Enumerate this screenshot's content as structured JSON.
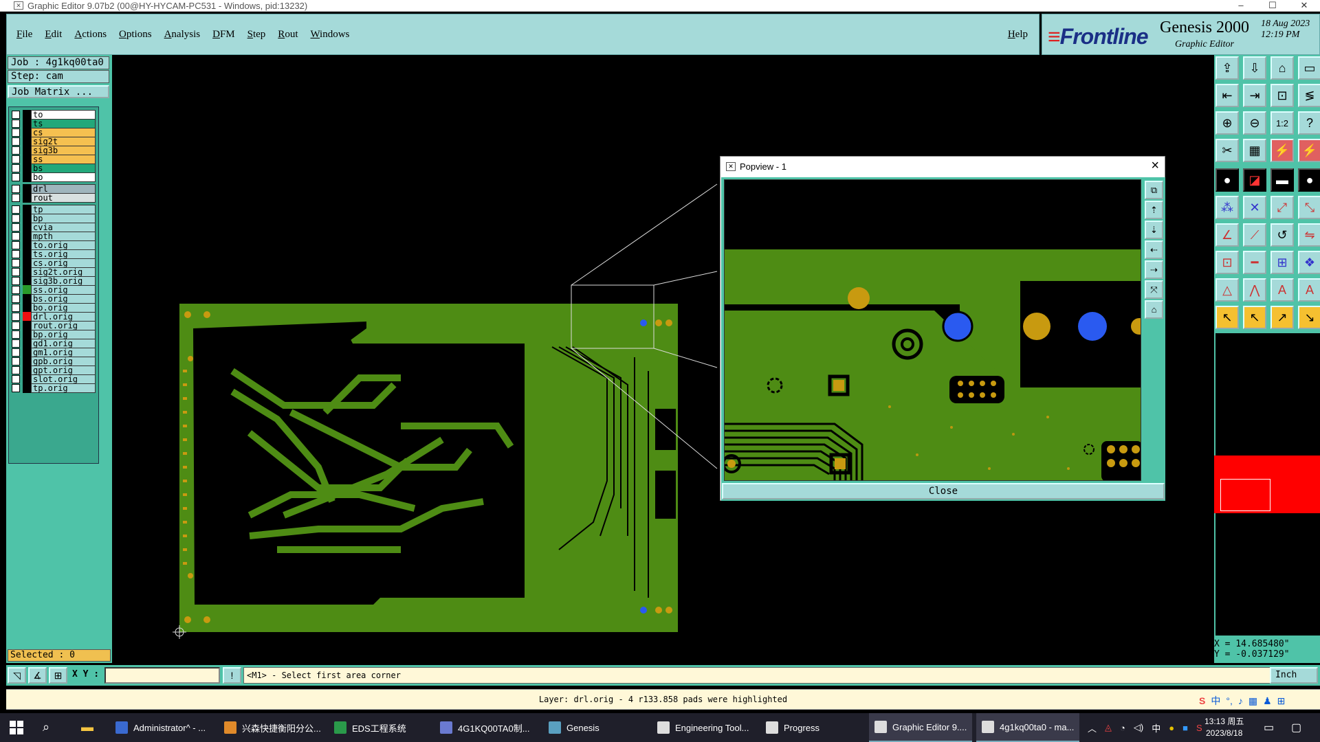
{
  "window": {
    "title": "Graphic Editor 9.07b2 (00@HY-HYCAM-PC531 - Windows, pid:13232)",
    "controls": [
      "–",
      "☐",
      "✕"
    ]
  },
  "menu": {
    "items": [
      "File",
      "Edit",
      "Actions",
      "Options",
      "Analysis",
      "DFM",
      "Step",
      "Rout",
      "Windows"
    ],
    "help": "Help"
  },
  "brand": {
    "logo": "Frontline",
    "product": "Genesis 2000",
    "subtitle": "Graphic Editor",
    "date": "18 Aug 2023\n12:19 PM"
  },
  "job": {
    "job_label": "Job : 4g1kq00ta0",
    "step_label": "Step: cam",
    "matrix_button": "Job Matrix ..."
  },
  "layers": [
    {
      "name": "to",
      "bg": "#ffffff",
      "color": "#000000"
    },
    {
      "name": "ts",
      "bg": "#23a87a",
      "color": "#000000"
    },
    {
      "name": "cs",
      "bg": "#f5c050",
      "color": "#000000"
    },
    {
      "name": "sig2t",
      "bg": "#f5c050",
      "color": "#000000"
    },
    {
      "name": "sig3b",
      "bg": "#f5c050",
      "color": "#000000"
    },
    {
      "name": "ss",
      "bg": "#f5c050",
      "color": "#000000"
    },
    {
      "name": "bs",
      "bg": "#23a87a",
      "color": "#000000"
    },
    {
      "name": "bo",
      "bg": "#ffffff",
      "color": "#000000"
    },
    {
      "name": "drl",
      "bg": "#9fb5bd",
      "color": "#000000"
    },
    {
      "name": "rout",
      "bg": "#d8e0e0",
      "color": "#000000"
    },
    {
      "name": "tp",
      "bg": "#a5dad9",
      "color": "#000000"
    },
    {
      "name": "bp",
      "bg": "#a5dad9",
      "color": "#000000"
    },
    {
      "name": "cvia",
      "bg": "#a5dad9",
      "color": "#000000"
    },
    {
      "name": "mpth",
      "bg": "#a5dad9",
      "color": "#000000"
    },
    {
      "name": "to.orig",
      "bg": "#a5dad9",
      "color": "#000000"
    },
    {
      "name": "ts.orig",
      "bg": "#a5dad9",
      "color": "#000000"
    },
    {
      "name": "cs.orig",
      "bg": "#a5dad9",
      "color": "#000000"
    },
    {
      "name": "sig2t.orig",
      "bg": "#a5dad9",
      "color": "#000000"
    },
    {
      "name": "sig3b.orig",
      "bg": "#a5dad9",
      "color": "#000000"
    },
    {
      "name": "ss.orig",
      "bg": "#a5dad9",
      "color": "#2a9a2a"
    },
    {
      "name": "bs.orig",
      "bg": "#a5dad9",
      "color": "#000000"
    },
    {
      "name": "bo.orig",
      "bg": "#a5dad9",
      "color": "#000000"
    },
    {
      "name": "drl.orig",
      "bg": "#a5dad9",
      "color": "#ee1111"
    },
    {
      "name": "rout.orig",
      "bg": "#a5dad9",
      "color": "#000000"
    },
    {
      "name": "bp.orig",
      "bg": "#a5dad9",
      "color": "#000000"
    },
    {
      "name": "gd1.orig",
      "bg": "#a5dad9",
      "color": "#000000"
    },
    {
      "name": "gm1.orig",
      "bg": "#a5dad9",
      "color": "#000000"
    },
    {
      "name": "gpb.orig",
      "bg": "#a5dad9",
      "color": "#000000"
    },
    {
      "name": "gpt.orig",
      "bg": "#a5dad9",
      "color": "#000000"
    },
    {
      "name": "slot.orig",
      "bg": "#a5dad9",
      "color": "#000000"
    },
    {
      "name": "tp.orig",
      "bg": "#a5dad9",
      "color": "#000000"
    }
  ],
  "selected": "Selected : 0",
  "popview": {
    "title": "Popview - 1",
    "close_button": "Close"
  },
  "coords": {
    "x": "X =  14.685480\"",
    "y": "Y = -0.037129\""
  },
  "command": {
    "xy_label": "X Y :",
    "xy_value": "",
    "prompt": "<M1> - Select first area corner",
    "unit": "Inch"
  },
  "status": "Layer: drl.orig - 4 r133.858 pads were highlighted",
  "taskbar": {
    "items": [
      {
        "label": "Administrator^ - ...",
        "color": "#3a6ad0"
      },
      {
        "label": "兴森快捷衡阳分公...",
        "color": "#e08a2a"
      },
      {
        "label": "EDS工程系统",
        "color": "#2a9a4a"
      },
      {
        "label": "4G1KQ00TA0制...",
        "color": "#6a7ad0"
      },
      {
        "label": "Genesis",
        "color": "#5aa0c0"
      },
      {
        "label": "Engineering Tool...",
        "color": "#dddddd"
      },
      {
        "label": "Progress",
        "color": "#dddddd"
      },
      {
        "label": "Graphic Editor 9....",
        "color": "#dddddd"
      },
      {
        "label": "4g1kq00ta0 - ma...",
        "color": "#dddddd"
      }
    ],
    "clock_time": "13:13 周五",
    "clock_date": "2023/8/18",
    "ime": "中"
  },
  "colors": {
    "panel": "#4fc3a8",
    "button": "#a5dad9",
    "board_green": "#4e8c14",
    "pad_gold": "#c89a10",
    "pad_blue": "#2a5af0"
  }
}
